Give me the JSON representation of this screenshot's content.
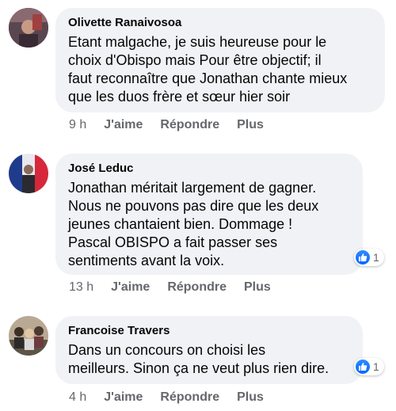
{
  "colors": {
    "bubble": "#f0f2f5",
    "meta_text": "#65676b",
    "like_blue": "#0866ff"
  },
  "actions": {
    "like": "J'aime",
    "reply": "Répondre",
    "more": "Plus"
  },
  "comments": [
    {
      "author": "Olivette Ranaivosoa",
      "lines": [
        "Etant malgache, je suis heureuse pour le",
        "choix d'Obispo mais Pour être objectif; il",
        "faut reconnaître que Jonathan chante mieux",
        "que les duos frère et sœur hier soir"
      ],
      "time": "9 h"
    },
    {
      "author": "José Leduc",
      "lines": [
        "Jonathan méritait largement de gagner.",
        "Nous ne pouvons pas dire que les deux",
        "jeunes chantaient bien. Dommage !",
        "Pascal OBISPO a fait passer ses",
        "sentiments avant la voix."
      ],
      "time": "13 h",
      "reaction_icon": "like-icon",
      "reaction_count": "1"
    },
    {
      "author": "Francoise Travers",
      "lines": [
        "Dans un concours on choisi les",
        "meilleurs. Sinon ça ne veut plus rien dire."
      ],
      "time": "4 h",
      "reaction_icon": "like-icon",
      "reaction_count": "1"
    }
  ]
}
